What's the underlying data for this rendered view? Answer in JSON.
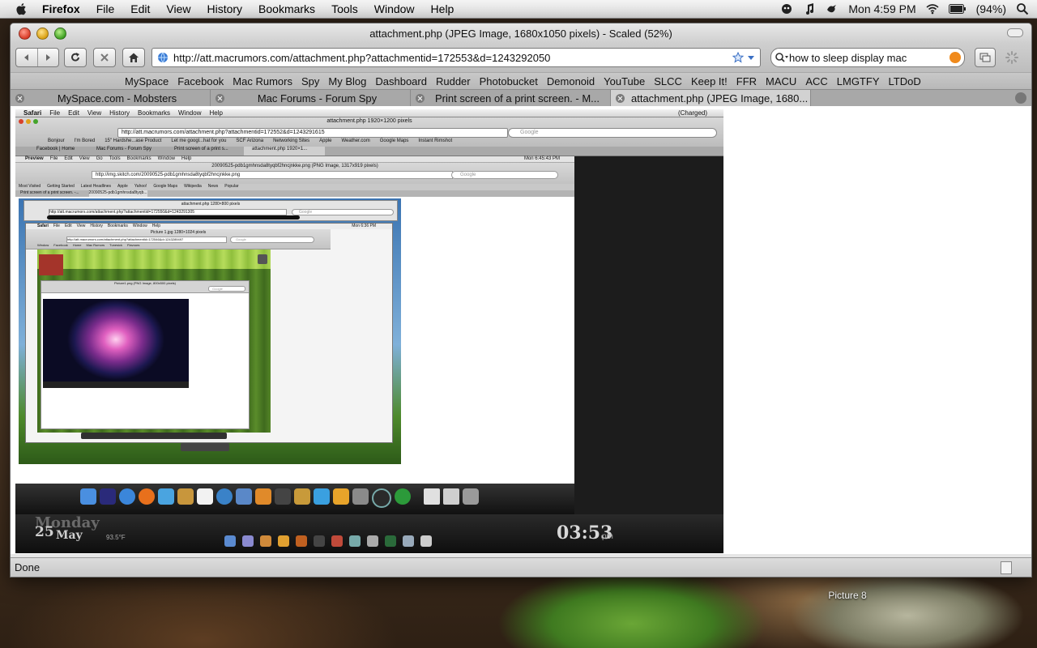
{
  "menubar": {
    "app": "Firefox",
    "items": [
      "File",
      "Edit",
      "View",
      "History",
      "Bookmarks",
      "Tools",
      "Window",
      "Help"
    ],
    "clock": "Mon 4:59 PM",
    "battery": "(94%)"
  },
  "window": {
    "title": "attachment.php (JPEG Image, 1680x1050 pixels) - Scaled (52%)"
  },
  "toolbar": {
    "url": "http://att.macrumors.com/attachment.php?attachmentid=172553&d=1243292050",
    "search_value": "how to sleep display mac"
  },
  "bookmarks": [
    "MySpace",
    "Facebook",
    "Mac Rumors",
    "Spy",
    "My Blog",
    "Dashboard",
    "Rudder",
    "Photobucket",
    "Demonoid",
    "YouTube",
    "SLCC",
    "Keep It!",
    "FFR",
    "MACU",
    "ACC",
    "LMGTFY",
    "LTDoD"
  ],
  "tabs": [
    {
      "title": "MySpace.com - Mobsters",
      "active": false
    },
    {
      "title": "Mac Forums - Forum Spy",
      "active": false
    },
    {
      "title": "Print screen of a print screen. - M...",
      "active": false
    },
    {
      "title": "attachment.php (JPEG Image, 1680...",
      "active": true
    }
  ],
  "status": "Done",
  "desktop": {
    "icon_label": "Picture 8"
  },
  "nested": {
    "l1": {
      "app": "Safari",
      "menus": [
        "File",
        "Edit",
        "View",
        "History",
        "Bookmarks",
        "Window",
        "Help"
      ],
      "status_right": "(Charged)",
      "title": "attachment.php 1920×1200 pixels",
      "url": "http://att.macrumors.com/attachment.php?attachmentid=172552&d=1243291615",
      "search_placeholder": "Google",
      "bookmarks": [
        "Bonjour",
        "I'm Bored",
        "15\" Hardshe...ase Product",
        "Let me googl...hat for you",
        "SCF Arizona",
        "Networking Sites",
        "Apple",
        "Weather.com",
        "Google Maps",
        "Instant Rimshot"
      ],
      "tabs": [
        "Facebook | Home",
        "Mac Forums - Forum Spy",
        "Print screen of a print s...",
        "attachment.php 1920×1..."
      ],
      "clock_big": "03:53",
      "clock_suffix": "pm",
      "date_num": "25",
      "date_month": "May",
      "date_day": "Monday",
      "temp": "93.5°F"
    },
    "l2": {
      "app": "Preview",
      "menus": [
        "File",
        "Edit",
        "View",
        "Go",
        "Tools",
        "Bookmarks",
        "Window",
        "Help"
      ],
      "clock": "Mon 6:45:43 PM",
      "title": "20090525-pdb1gmhnsda8tyqbf2hncjnkke.png (PNG Image, 1317x919 pixels)",
      "url": "http://img.skitch.com/20090525-pdb1gmhnsda8tyqbf2hncjnkke.png",
      "search_placeholder": "Google",
      "bookmarks": [
        "Most Visited",
        "Getting Started",
        "Latest Headlines",
        "Apple",
        "Yahoo!",
        "Google Maps",
        "Wikipedia",
        "News",
        "Popular"
      ],
      "tabs": [
        "Print screen of a print screen. -...",
        "20090525-pdb1gmhnsda8tyqb..."
      ]
    },
    "l3": {
      "title": "attachment.php 1280×800 pixels",
      "url": "http://att.macrumors.com/attachment.php?attachmentid=172550&d=1243291305",
      "search_placeholder": "Google"
    },
    "l4": {
      "app": "Safari",
      "menus": [
        "File",
        "Edit",
        "View",
        "History",
        "Bookmarks",
        "Window",
        "Help"
      ],
      "clock": "Mon 6:36 PM",
      "title": "Picture 1.jpg 1280×1024 pixels",
      "url": "http://att.macrumors.com/attachment.php?attachmentid=172546&d=1243289497",
      "search_placeholder": "Google",
      "bookmarks": [
        "Window",
        "Facebook",
        "Home",
        "Mac Rumors",
        "Tunesick",
        "Flavours"
      ]
    },
    "l5": {
      "title": "Picture1.png (PNG Image, 800x500 pixels)",
      "search_placeholder": "Google"
    }
  }
}
